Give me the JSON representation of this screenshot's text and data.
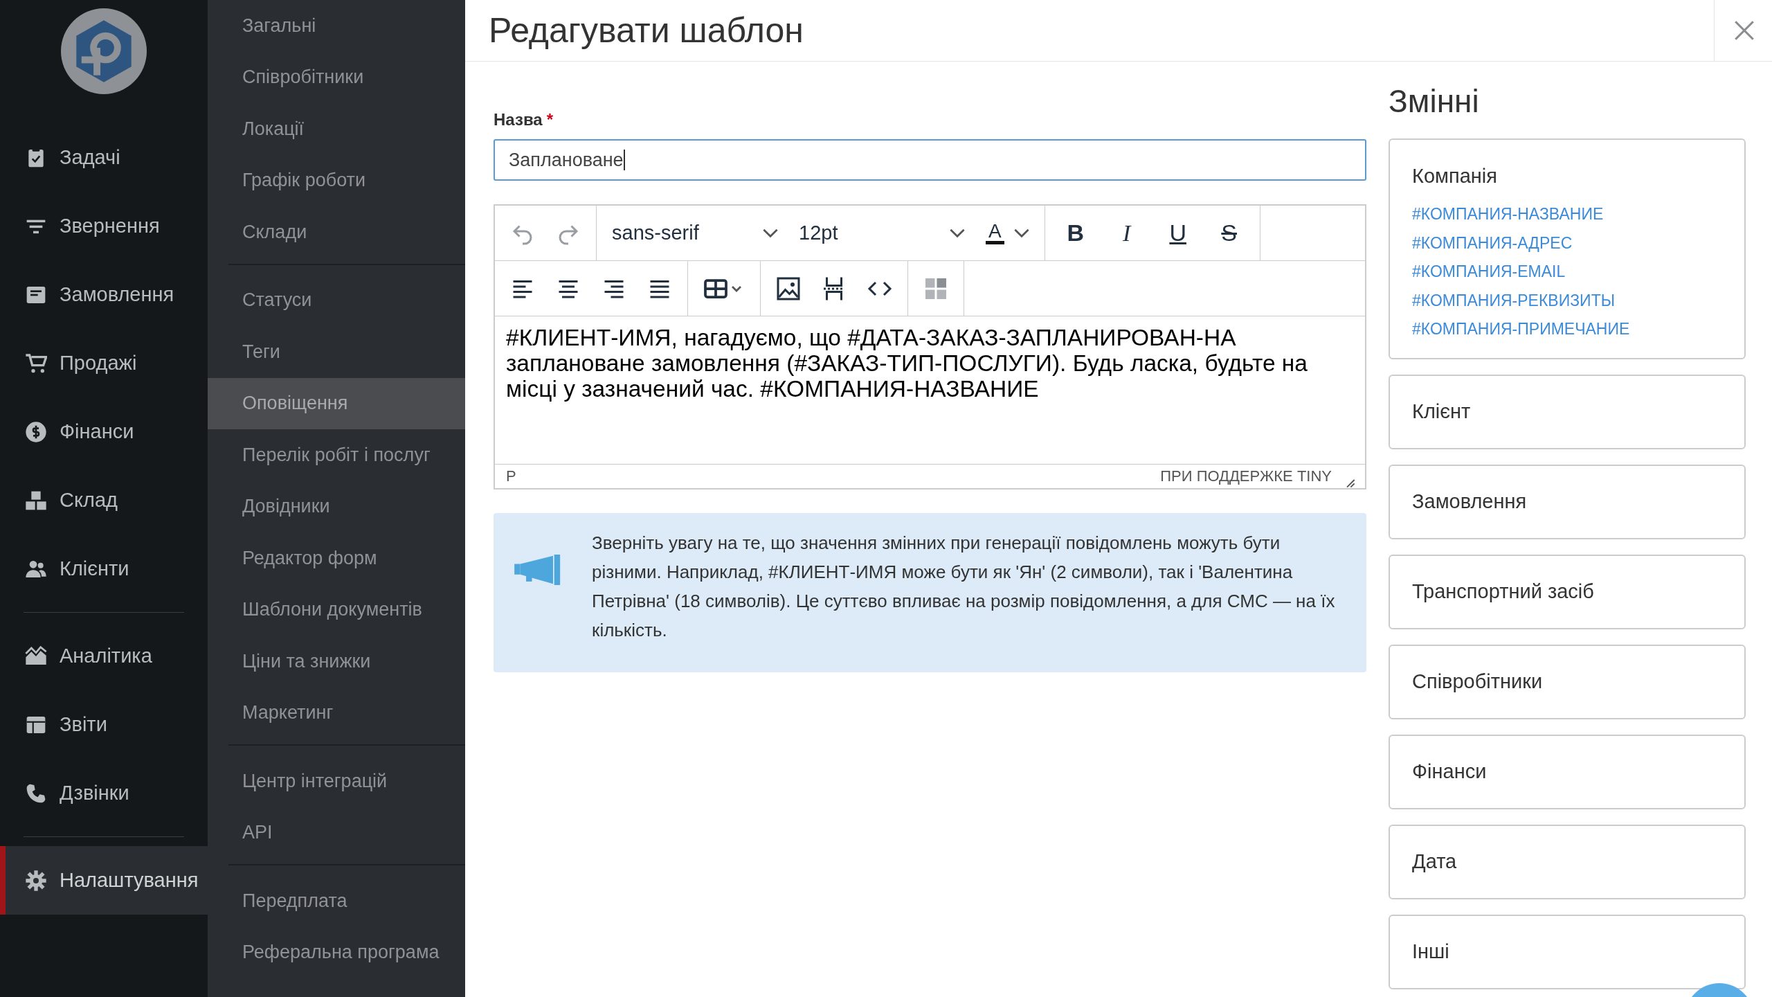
{
  "sidebar": {
    "groups": [
      [
        {
          "label": "Задачі",
          "selected": false
        },
        {
          "label": "Звернення",
          "selected": false
        },
        {
          "label": "Замовлення",
          "selected": false
        },
        {
          "label": "Продажі",
          "selected": false
        },
        {
          "label": "Фінанси",
          "selected": false
        },
        {
          "label": "Склад",
          "selected": false
        },
        {
          "label": "Клієнти",
          "selected": false
        }
      ],
      [
        {
          "label": "Аналітика",
          "selected": false
        },
        {
          "label": "Звіти",
          "selected": false
        },
        {
          "label": "Дзвінки",
          "selected": false
        }
      ],
      [
        {
          "label": "Налаштування",
          "selected": true
        }
      ]
    ]
  },
  "submenu": {
    "groups": [
      [
        {
          "label": "Загальні",
          "selected": false
        },
        {
          "label": "Співробітники",
          "selected": false
        },
        {
          "label": "Локації",
          "selected": false
        },
        {
          "label": "Графік роботи",
          "selected": false
        },
        {
          "label": "Склади",
          "selected": false
        }
      ],
      [
        {
          "label": "Статуси",
          "selected": false
        },
        {
          "label": "Теги",
          "selected": false
        },
        {
          "label": "Оповіщення",
          "selected": true
        },
        {
          "label": "Перелік робіт і послуг",
          "selected": false
        },
        {
          "label": "Довідники",
          "selected": false
        },
        {
          "label": "Редактор форм",
          "selected": false
        },
        {
          "label": "Шаблони документів",
          "selected": false
        },
        {
          "label": "Ціни та знижки",
          "selected": false
        },
        {
          "label": "Маркетинг",
          "selected": false
        }
      ],
      [
        {
          "label": "Центр інтеграцій",
          "selected": false
        },
        {
          "label": "API",
          "selected": false
        }
      ],
      [
        {
          "label": "Передплата",
          "selected": false
        },
        {
          "label": "Реферальна програма",
          "selected": false
        }
      ]
    ]
  },
  "header": {
    "title": "Редагувати шаблон"
  },
  "form": {
    "label": "Назва",
    "required_mark": "*",
    "value": "Заплановане"
  },
  "editor": {
    "font": "sans-serif",
    "size": "12pt",
    "color_button": "A",
    "format_buttons": [
      "B",
      "I",
      "U",
      "S"
    ],
    "content": "#КЛИЕНТ-ИМЯ, нагадуємо, що #ДАТА-ЗАКАЗ-ЗАПЛАНИРОВАН-НА заплановане замовлення (#ЗАКАЗ-ТИП-ПОСЛУГИ). Будь ласка, будьте на місці у зазначений час. #КОМПАНИЯ-НАЗВАНИЕ",
    "path": "P",
    "branding": "ПРИ ПОДДЕРЖКЕ TINY"
  },
  "notice": {
    "text": "Зверніть увагу на те, що значення змінних при генерації повідомлень можуть бути різними. Наприклад, #КЛИЕНТ-ИМЯ може бути як 'Ян' (2 символи), так і 'Валентина Петрівна' (18 символів). Це суттєво впливає на розмір повідомлення, а для СМС — на їх кількість."
  },
  "variables": {
    "title": "Змінні",
    "groups": [
      {
        "name": "Компанія",
        "expanded": true,
        "items": [
          "#КОМПАНИЯ-НАЗВАНИЕ",
          "#КОМПАНИЯ-АДРЕС",
          "#КОМПАНИЯ-EMAIL",
          "#КОМПАНИЯ-РЕКВИЗИТЫ",
          "#КОМПАНИЯ-ПРИМЕЧАНИЕ"
        ]
      },
      {
        "name": "Клієнт",
        "expanded": false
      },
      {
        "name": "Замовлення",
        "expanded": false
      },
      {
        "name": "Транспортний засіб",
        "expanded": false
      },
      {
        "name": "Співробітники",
        "expanded": false
      },
      {
        "name": "Фінанси",
        "expanded": false
      },
      {
        "name": "Дата",
        "expanded": false
      },
      {
        "name": "Інші",
        "expanded": false
      }
    ]
  }
}
